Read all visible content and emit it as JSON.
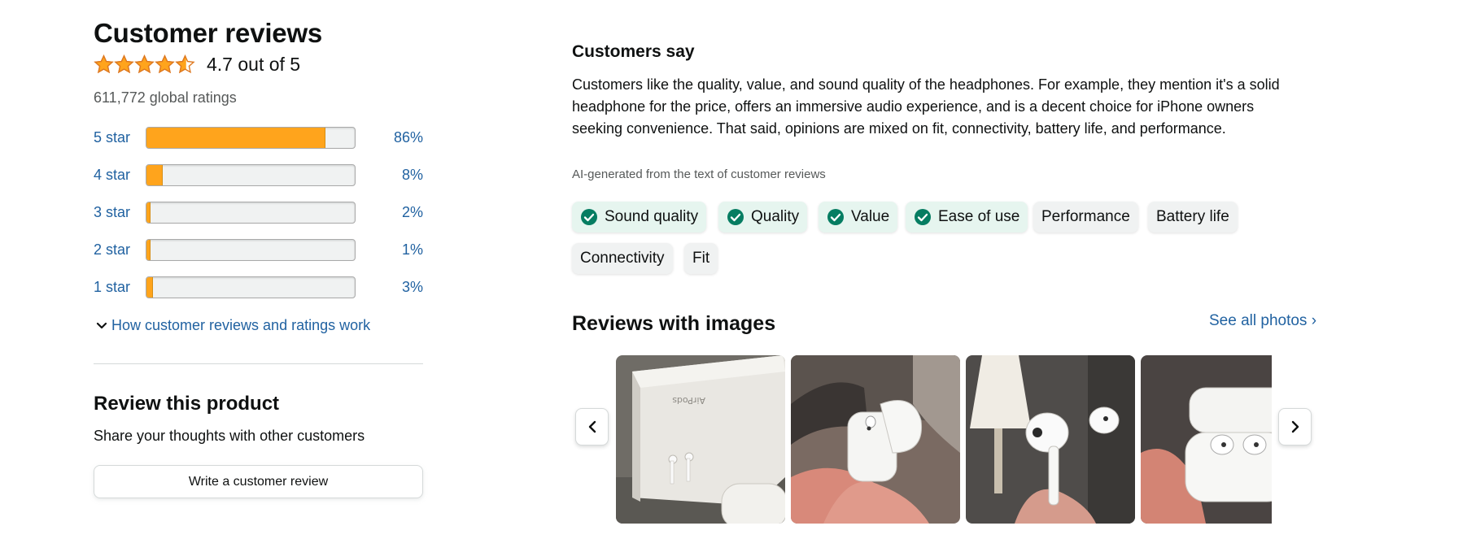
{
  "customer_reviews": {
    "title": "Customer reviews",
    "rating_value": 4.7,
    "rating_text": "4.7 out of 5",
    "star_color": "#ffa41c",
    "global_ratings": "611,772 global ratings",
    "histogram": [
      {
        "label": "5 star",
        "percent": 86,
        "percent_text": "86%"
      },
      {
        "label": "4 star",
        "percent": 8,
        "percent_text": "8%"
      },
      {
        "label": "3 star",
        "percent": 2,
        "percent_text": "2%"
      },
      {
        "label": "2 star",
        "percent": 1,
        "percent_text": "1%"
      },
      {
        "label": "1 star",
        "percent": 3,
        "percent_text": "3%"
      }
    ],
    "how_it_works_link": "How customer reviews and ratings work",
    "how_it_works_icon": "chevron-down-icon"
  },
  "review_product": {
    "title": "Review this product",
    "subtitle": "Share your thoughts with other customers",
    "button_label": "Write a customer review"
  },
  "customers_say": {
    "title": "Customers say",
    "body": "Customers like the quality, value, and sound quality of the headphones. For example, they mention it's a solid headphone for the price, offers an immersive audio experience, and is a decent choice for iPhone owners seeking convenience. That said, opinions are mixed on fit, connectivity, battery life, and performance.",
    "ai_note": "AI-generated from the text of customer reviews",
    "positive_color": "#067d62",
    "chips": [
      {
        "label": "Sound quality",
        "positive": true
      },
      {
        "label": "Quality",
        "positive": true
      },
      {
        "label": "Value",
        "positive": true
      },
      {
        "label": "Ease of use",
        "positive": true
      },
      {
        "label": "Performance",
        "positive": false
      },
      {
        "label": "Battery life",
        "positive": false
      },
      {
        "label": "Connectivity",
        "positive": false
      },
      {
        "label": "Fit",
        "positive": false
      }
    ]
  },
  "reviews_with_images": {
    "title": "Reviews with images",
    "see_all": "See all photos ›",
    "prev_icon": "chevron-left-icon",
    "next_icon": "chevron-right-icon",
    "box_text": "AirPods",
    "images": [
      {
        "subject": "airpods-box-photo"
      },
      {
        "subject": "airpods-open-case-photo"
      },
      {
        "subject": "airpods-earbuds-photo"
      },
      {
        "subject": "airpods-case-in-hand-photo"
      }
    ]
  },
  "link_color": "#2162a1"
}
